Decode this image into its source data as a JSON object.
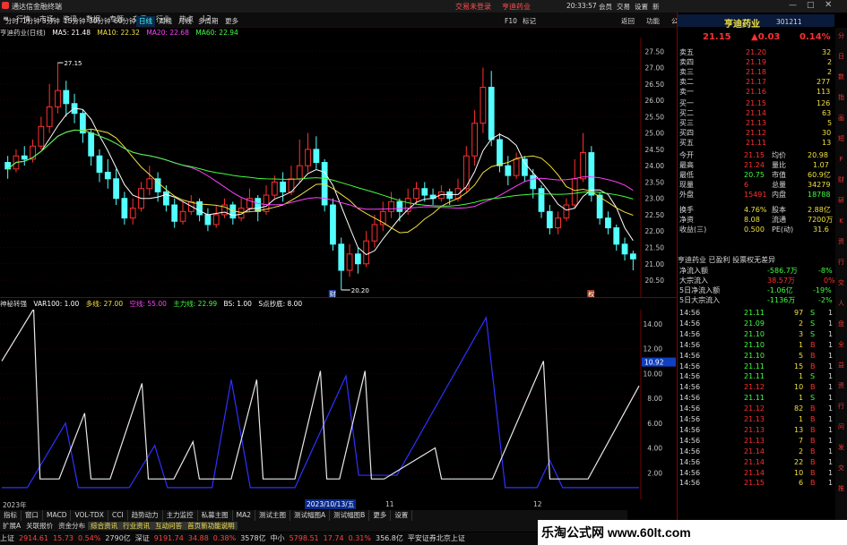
{
  "titlebar": {
    "app_title": "通达信金融终端",
    "center_links": [
      "交易未登录",
      "亨迪药业"
    ],
    "time": "20:33:57",
    "right_items": [
      "会员",
      "交易",
      "设置",
      "新",
      "一"
    ]
  },
  "menubar": {
    "items": [
      "行情",
      "市场",
      "资讯",
      "数据",
      "专题",
      "交易",
      "行业",
      "热点",
      "L2"
    ],
    "periods": [
      "分时",
      "1分钟",
      "5分钟",
      "15分钟",
      "30分钟",
      "60分钟",
      "日线",
      "周线",
      "月线",
      "多周期",
      "更多"
    ],
    "active_period": "日线",
    "right_tools": [
      "F10",
      "标记",
      "返回",
      "功能",
      "公式",
      "选股",
      "返回"
    ]
  },
  "chart_info": {
    "name": "亨迪药业(日线)",
    "ma": [
      {
        "label": "MA5: 21.48",
        "color": "#ffffff"
      },
      {
        "label": "MA10: 22.32",
        "color": "#f0e040"
      },
      {
        "label": "MA20: 22.68",
        "color": "#ff40ff"
      },
      {
        "label": "MA60: 22.94",
        "color": "#40ff40"
      }
    ]
  },
  "indicator_info": {
    "name": "神秘转强",
    "items": [
      {
        "label": "VAR100: 1.00",
        "color": "#ffffff"
      },
      {
        "label": "多线: 27.00",
        "color": "#f0e040"
      },
      {
        "label": "空线: 55.00",
        "color": "#ff40ff"
      },
      {
        "label": "主力线: 22.99",
        "color": "#40ff40"
      },
      {
        "label": "BS: 1.00",
        "color": "#ffffff"
      },
      {
        "label": "S点抄底: 8.00",
        "color": "#ffffff"
      }
    ]
  },
  "main_axis": [
    "27.50",
    "27.00",
    "26.50",
    "26.00",
    "25.50",
    "25.00",
    "24.50",
    "24.00",
    "23.50",
    "23.00",
    "22.50",
    "22.00",
    "21.50",
    "21.00",
    "20.50"
  ],
  "ind_axis": [
    "14.00",
    "12.00",
    "10.00",
    "8.00",
    "6.00",
    "4.00",
    "2.00"
  ],
  "ind_current_value": "10.92",
  "price_marks": {
    "high": "27.15",
    "low": "20.20"
  },
  "time_axis": {
    "left": "2023年",
    "cursor": "2023/10/13/五",
    "m11": "11",
    "m12": "12"
  },
  "chart_tags": [
    "财",
    "权"
  ],
  "bottom_tabs": [
    "指标",
    "窗口",
    "MACD",
    "VOL-TDX",
    "CCI",
    "趋势动力",
    "主力监控",
    "私募主图",
    "MA2",
    "测试主图",
    "测试幅图A",
    "测试幅图B",
    "更多",
    "设置"
  ],
  "bottom_tabs2": [
    "扩展A",
    "关联报价",
    "资金分布",
    "综合资讯",
    "行业资讯",
    "互动问答",
    "首页新功能说明"
  ],
  "statusbar": [
    {
      "text": "上证",
      "color": "#d8d8d8"
    },
    {
      "text": "2914.61",
      "color": "#ff4040"
    },
    {
      "text": "15.73",
      "color": "#ff4040"
    },
    {
      "text": "0.54%",
      "color": "#ff4040"
    },
    {
      "text": "2790亿",
      "color": "#d8d8d8"
    },
    {
      "text": "深证",
      "color": "#d8d8d8"
    },
    {
      "text": "9191.74",
      "color": "#ff4040"
    },
    {
      "text": "34.88",
      "color": "#ff4040"
    },
    {
      "text": "0.38%",
      "color": "#ff4040"
    },
    {
      "text": "3578亿",
      "color": "#d8d8d8"
    },
    {
      "text": "中小",
      "color": "#d8d8d8"
    },
    {
      "text": "5798.51",
      "color": "#ff4040"
    },
    {
      "text": "17.74",
      "color": "#ff4040"
    },
    {
      "text": "0.31%",
      "color": "#ff4040"
    },
    {
      "text": "356.8亿",
      "color": "#d8d8d8"
    },
    {
      "text": "平安证券北京上证",
      "color": "#d8d8d8"
    }
  ],
  "brand_banner": "乐淘公式网 www.60lt.com",
  "right_panel": {
    "stock_name": "亨迪药业",
    "stock_code": "301211",
    "price": "21.15",
    "change": "▲0.03",
    "change_pct": "0.14%",
    "asks": [
      {
        "label": "卖五",
        "price": "21.20",
        "vol": "32"
      },
      {
        "label": "卖四",
        "price": "21.19",
        "vol": "2"
      },
      {
        "label": "卖三",
        "price": "21.18",
        "vol": "2"
      },
      {
        "label": "卖二",
        "price": "21.17",
        "vol": "277"
      },
      {
        "label": "卖一",
        "price": "21.16",
        "vol": "113"
      }
    ],
    "bids": [
      {
        "label": "买一",
        "price": "21.15",
        "vol": "126"
      },
      {
        "label": "买二",
        "price": "21.14",
        "vol": "63"
      },
      {
        "label": "买三",
        "price": "21.13",
        "vol": "5"
      },
      {
        "label": "买四",
        "price": "21.12",
        "vol": "30"
      },
      {
        "label": "买五",
        "price": "21.11",
        "vol": "13"
      }
    ],
    "stats": [
      {
        "k1": "今开",
        "v1": "21.15",
        "k2": "均价",
        "v2": "20.98"
      },
      {
        "k1": "最高",
        "v1": "21.24",
        "k2": "量比",
        "v2": "1.07"
      },
      {
        "k1": "最低",
        "v1": "20.75",
        "k2": "市值",
        "v2": "60.9亿"
      },
      {
        "k1": "现量",
        "v1": "6",
        "k2": "总量",
        "v2": "34279"
      },
      {
        "k1": "外盘",
        "v1": "15491",
        "k2": "内盘",
        "v2": "18788"
      },
      {
        "k1": "换手",
        "v1": "4.76%",
        "k2": "股本",
        "v2": "2.88亿"
      },
      {
        "k1": "净资",
        "v1": "8.08",
        "k2": "流通",
        "v2": "7200万"
      },
      {
        "k1": "收益(三)",
        "v1": "0.500",
        "k2": "PE(动)",
        "v2": "31.6"
      }
    ],
    "info_line": "亨迪药业 已盈利 投票权无差异",
    "flows": [
      {
        "label": "净流入额",
        "value": "-586.7万",
        "pct": "-8%"
      },
      {
        "label": "大宗流入",
        "value": "38.57万",
        "pct": "0%"
      },
      {
        "label": "5日净流入额",
        "value": "-1.06亿",
        "pct": "-19%"
      },
      {
        "label": "5日大宗流入",
        "value": "-1136万",
        "pct": "-2%"
      }
    ],
    "ticks": [
      {
        "t": "14:56",
        "p": "21.11",
        "v": "97",
        "d": "S",
        "n": "1"
      },
      {
        "t": "14:56",
        "p": "21.09",
        "v": "2",
        "d": "S",
        "n": "1"
      },
      {
        "t": "14:56",
        "p": "21.10",
        "v": "3",
        "d": "S",
        "n": "1"
      },
      {
        "t": "14:56",
        "p": "21.10",
        "v": "1",
        "d": "B",
        "n": "1"
      },
      {
        "t": "14:56",
        "p": "21.10",
        "v": "5",
        "d": "B",
        "n": "1"
      },
      {
        "t": "14:56",
        "p": "21.11",
        "v": "15",
        "d": "B",
        "n": "1"
      },
      {
        "t": "14:56",
        "p": "21.11",
        "v": "1",
        "d": "S",
        "n": "1"
      },
      {
        "t": "14:56",
        "p": "21.12",
        "v": "10",
        "d": "B",
        "n": "1"
      },
      {
        "t": "14:56",
        "p": "21.11",
        "v": "1",
        "d": "S",
        "n": "1"
      },
      {
        "t": "14:56",
        "p": "21.12",
        "v": "82",
        "d": "B",
        "n": "1"
      },
      {
        "t": "14:56",
        "p": "21.13",
        "v": "1",
        "d": "B",
        "n": "1"
      },
      {
        "t": "14:56",
        "p": "21.13",
        "v": "13",
        "d": "B",
        "n": "1"
      },
      {
        "t": "14:56",
        "p": "21.13",
        "v": "7",
        "d": "B",
        "n": "1"
      },
      {
        "t": "14:56",
        "p": "21.14",
        "v": "2",
        "d": "B",
        "n": "1"
      },
      {
        "t": "14:56",
        "p": "21.14",
        "v": "22",
        "d": "B",
        "n": "1"
      },
      {
        "t": "14:56",
        "p": "21.14",
        "v": "10",
        "d": "B",
        "n": "1"
      },
      {
        "t": "14:56",
        "p": "21.15",
        "v": "6",
        "d": "B",
        "n": "1"
      }
    ]
  },
  "side_icons": [
    "分",
    "日",
    "数",
    "指",
    "画",
    "短",
    "F",
    "财",
    "研",
    "K",
    "资",
    "行",
    "交",
    "人",
    "盘",
    "全",
    "益",
    "资",
    "行",
    "问",
    "发",
    "交",
    "推"
  ],
  "colors": {
    "up": "#ff3030",
    "down": "#54ffff",
    "ma5": "#ffffff",
    "ma10": "#f0e040",
    "ma20": "#ff40ff",
    "ma60": "#40ff40",
    "ind_white": "#e8e8e8",
    "ind_blue": "#3030ff"
  },
  "chart_data": {
    "type": "candlestick",
    "ylim": [
      20.2,
      27.7
    ],
    "candles": [
      [
        24.1,
        23.9,
        24.3,
        23.6
      ],
      [
        23.9,
        24.3,
        24.5,
        23.8
      ],
      [
        24.3,
        24.2,
        24.6,
        24.0
      ],
      [
        24.2,
        24.6,
        24.8,
        24.1
      ],
      [
        24.6,
        25.2,
        25.5,
        24.5
      ],
      [
        25.2,
        25.8,
        26.5,
        25.0
      ],
      [
        25.8,
        26.3,
        27.15,
        25.6
      ],
      [
        26.3,
        25.9,
        26.6,
        25.5
      ],
      [
        25.9,
        25.6,
        26.2,
        25.3
      ],
      [
        25.6,
        25.0,
        25.7,
        24.7
      ],
      [
        25.0,
        24.3,
        25.1,
        24.0
      ],
      [
        24.3,
        23.8,
        24.5,
        23.5
      ],
      [
        23.8,
        23.6,
        24.2,
        23.3
      ],
      [
        23.6,
        23.0,
        23.9,
        22.8
      ],
      [
        23.0,
        22.4,
        23.2,
        22.2
      ],
      [
        22.4,
        22.7,
        23.0,
        22.2
      ],
      [
        22.7,
        23.3,
        23.5,
        22.6
      ],
      [
        23.3,
        23.6,
        24.0,
        23.1
      ],
      [
        23.6,
        23.2,
        23.8,
        22.9
      ],
      [
        23.2,
        22.8,
        23.4,
        22.6
      ],
      [
        22.8,
        22.3,
        23.0,
        22.1
      ],
      [
        22.3,
        22.6,
        22.9,
        22.2
      ],
      [
        22.6,
        22.9,
        23.1,
        22.5
      ],
      [
        22.9,
        22.5,
        23.0,
        22.3
      ],
      [
        22.5,
        22.2,
        22.7,
        22.0
      ],
      [
        22.2,
        22.5,
        22.8,
        22.1
      ],
      [
        22.5,
        22.8,
        23.0,
        22.4
      ],
      [
        22.8,
        22.4,
        22.9,
        22.2
      ],
      [
        22.4,
        22.7,
        23.0,
        22.3
      ],
      [
        22.7,
        23.0,
        23.3,
        22.6
      ],
      [
        23.0,
        22.6,
        23.1,
        22.3
      ],
      [
        22.6,
        23.1,
        23.4,
        22.5
      ],
      [
        23.1,
        23.5,
        23.7,
        23.0
      ],
      [
        23.5,
        23.2,
        23.8,
        22.9
      ],
      [
        23.2,
        23.6,
        24.0,
        23.1
      ],
      [
        23.6,
        24.0,
        24.8,
        23.5
      ],
      [
        24.0,
        24.5,
        25.0,
        23.8
      ],
      [
        24.5,
        24.1,
        24.9,
        23.9
      ],
      [
        24.1,
        22.8,
        24.2,
        22.6
      ],
      [
        22.8,
        21.6,
        23.0,
        21.4
      ],
      [
        21.6,
        20.8,
        21.8,
        20.2
      ],
      [
        20.8,
        21.3,
        21.6,
        20.6
      ],
      [
        21.3,
        21.0,
        21.5,
        20.7
      ],
      [
        21.0,
        21.7,
        22.0,
        20.9
      ],
      [
        21.7,
        22.2,
        22.5,
        21.5
      ],
      [
        22.2,
        22.6,
        22.9,
        22.0
      ],
      [
        22.6,
        22.9,
        23.2,
        22.4
      ],
      [
        22.9,
        22.6,
        23.0,
        22.3
      ],
      [
        22.6,
        23.0,
        23.3,
        22.5
      ],
      [
        23.0,
        23.3,
        23.5,
        22.8
      ],
      [
        23.3,
        23.1,
        23.5,
        22.9
      ],
      [
        23.1,
        23.0,
        23.3,
        22.8
      ],
      [
        23.0,
        23.2,
        23.4,
        22.9
      ],
      [
        23.2,
        23.0,
        23.3,
        22.8
      ],
      [
        23.0,
        23.3,
        23.6,
        22.9
      ],
      [
        23.3,
        24.3,
        24.6,
        23.2
      ],
      [
        24.3,
        25.3,
        25.7,
        24.0
      ],
      [
        25.3,
        26.4,
        27.0,
        25.0
      ],
      [
        26.4,
        24.8,
        26.9,
        24.6
      ],
      [
        24.8,
        24.0,
        25.0,
        23.8
      ],
      [
        24.0,
        23.7,
        24.3,
        23.4
      ],
      [
        23.7,
        24.2,
        24.4,
        23.6
      ],
      [
        24.2,
        23.7,
        24.3,
        23.5
      ],
      [
        23.7,
        23.3,
        23.9,
        23.0
      ],
      [
        23.3,
        22.6,
        23.4,
        22.4
      ],
      [
        22.6,
        22.1,
        22.8,
        21.9
      ],
      [
        22.1,
        22.4,
        22.6,
        21.9
      ],
      [
        22.4,
        22.8,
        23.0,
        22.3
      ],
      [
        22.8,
        23.6,
        24.2,
        22.7
      ],
      [
        23.6,
        24.4,
        25.0,
        23.5
      ],
      [
        24.4,
        23.1,
        24.6,
        22.9
      ],
      [
        23.1,
        22.4,
        23.2,
        22.2
      ],
      [
        22.4,
        22.1,
        22.6,
        21.9
      ],
      [
        22.1,
        21.6,
        22.2,
        21.4
      ],
      [
        21.6,
        21.3,
        21.8,
        21.1
      ],
      [
        21.3,
        21.15,
        21.4,
        20.8
      ]
    ],
    "series": [
      {
        "name": "MA5",
        "color": "#ffffff"
      },
      {
        "name": "MA10",
        "color": "#f0e040"
      },
      {
        "name": "MA20",
        "color": "#ff40ff"
      },
      {
        "name": "MA60",
        "color": "#40ff40"
      }
    ],
    "indicator": {
      "ylim": [
        0,
        15
      ],
      "white": [
        [
          0,
          11
        ],
        [
          5,
          15.2
        ],
        [
          6,
          1.5
        ],
        [
          9,
          1.5
        ],
        [
          13,
          6.8
        ],
        [
          14,
          1.5
        ],
        [
          17,
          1.5
        ],
        [
          22,
          9.2
        ],
        [
          23,
          1.5
        ],
        [
          27,
          1.5
        ],
        [
          30,
          4.5
        ],
        [
          31,
          1.5
        ],
        [
          36,
          1.5
        ],
        [
          40,
          9.5
        ],
        [
          41,
          1.5
        ],
        [
          46,
          1.5
        ],
        [
          50,
          10.2
        ],
        [
          51,
          1.5
        ],
        [
          53,
          1.5
        ],
        [
          57,
          10.2
        ],
        [
          58,
          1.5
        ],
        [
          60,
          1.5
        ],
        [
          68,
          4
        ],
        [
          69,
          1.5
        ],
        [
          77,
          1.5
        ],
        [
          85,
          11
        ],
        [
          86,
          1.5
        ],
        [
          92,
          1.5
        ],
        [
          100,
          9
        ]
      ],
      "blue": [
        [
          0,
          0.8
        ],
        [
          4,
          0.8
        ],
        [
          10,
          6
        ],
        [
          12,
          0.8
        ],
        [
          20,
          0.8
        ],
        [
          24,
          4.2
        ],
        [
          26,
          0.8
        ],
        [
          33,
          0.8
        ],
        [
          36,
          9.5
        ],
        [
          39,
          0.8
        ],
        [
          46,
          0.8
        ],
        [
          54,
          9.8
        ],
        [
          56,
          1.8
        ],
        [
          62,
          1.8
        ],
        [
          76,
          14.5
        ],
        [
          79,
          0.8
        ],
        [
          84,
          0.8
        ],
        [
          86,
          3
        ],
        [
          88,
          0.8
        ],
        [
          100,
          0.8
        ]
      ]
    }
  }
}
